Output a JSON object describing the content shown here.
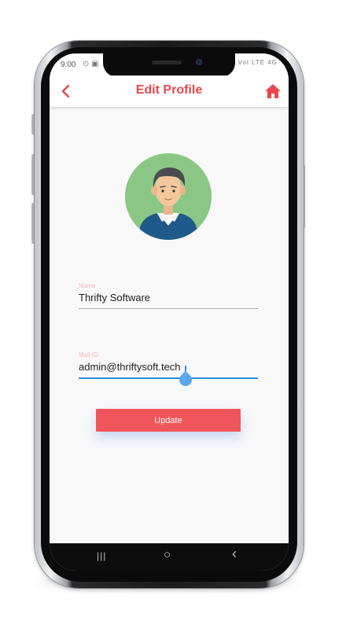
{
  "status_bar": {
    "time": "9:00",
    "left_icons": [
      "alarm-icon",
      "image-icon"
    ],
    "right_text": "Vol LTE 4G"
  },
  "app_bar": {
    "title": "Edit Profile",
    "back_icon": "chevron-left-icon",
    "home_icon": "home-icon"
  },
  "profile": {
    "avatar": "user-avatar"
  },
  "form": {
    "name": {
      "label": "Name",
      "value": "Thrifty Software"
    },
    "mail": {
      "label": "Mail ID",
      "value": "admin@thriftysoft.tech"
    },
    "submit_label": "Update"
  },
  "nav_bar": {
    "recents_glyph": "|||",
    "home_glyph": "○",
    "back_glyph": "‹"
  },
  "colors": {
    "accent": "#e8474f",
    "button": "#f0555b",
    "focus": "#2d8fdd"
  }
}
